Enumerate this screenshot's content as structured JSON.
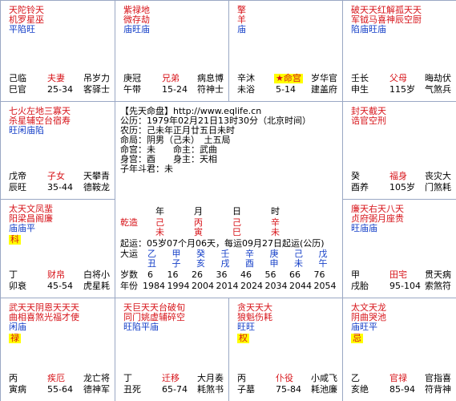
{
  "palaces": [
    {
      "id": "si",
      "stars": [
        [
          "天陀铃天",
          "red"
        ],
        [
          "机罗星巫",
          "red"
        ],
        [
          "平陷旺",
          "blue"
        ]
      ],
      "hua": "",
      "bottom": [
        [
          "己临",
          "夫妻",
          "吊岁力"
        ],
        [
          "巳官",
          "25-34",
          "客驿士"
        ]
      ]
    },
    {
      "id": "wu",
      "stars": [
        [
          "紫禄地",
          "red"
        ],
        [
          "微存劫",
          "red"
        ],
        [
          "庙旺庙",
          "blue"
        ]
      ],
      "hua": "",
      "bottom": [
        [
          "庚冠",
          "兄弟",
          "病息博"
        ],
        [
          "午带",
          "15-24",
          "符神士"
        ]
      ]
    },
    {
      "id": "wei",
      "stars": [
        [
          "擎",
          "red"
        ],
        [
          "羊",
          "red"
        ],
        [
          "庙",
          "blue"
        ]
      ],
      "hua": "",
      "bottom": [
        [
          "辛沐",
          "★命宫",
          "岁华官"
        ],
        [
          "未浴",
          "5-14",
          "建盖府"
        ]
      ]
    },
    {
      "id": "shen",
      "stars": [
        [
          "破天天红解孤天天",
          "red"
        ],
        [
          "军钺马喜神辰空厨",
          "red"
        ],
        [
          "陷庙旺庙",
          "blue"
        ]
      ],
      "hua": "",
      "bottom": [
        [
          "壬长",
          "父母",
          "晦劫伏"
        ],
        [
          "申生",
          "115岁",
          "气煞兵"
        ]
      ]
    },
    {
      "id": "chen",
      "stars": [
        [
          "七火左地三寡天",
          "red"
        ],
        [
          "杀星辅空台宿寿",
          "red"
        ],
        [
          "旺闲庙陷",
          "blue"
        ]
      ],
      "hua": "",
      "bottom": [
        [
          "戊帝",
          "子女",
          "天攀青"
        ],
        [
          "辰旺",
          "35-44",
          "德鞍龙"
        ]
      ]
    },
    {
      "id": "you",
      "stars": [
        [
          "封天截天",
          "red"
        ],
        [
          "诰官空刑",
          "red"
        ]
      ],
      "hua": "",
      "bottom": [
        [
          "癸",
          "福身",
          "丧灾大"
        ],
        [
          "酉养",
          "105岁",
          "门煞耗"
        ]
      ]
    },
    {
      "id": "mao",
      "stars": [
        [
          "太天文凤蜚",
          "red"
        ],
        [
          "阳梁昌阁廉",
          "red"
        ],
        [
          "庙庙平",
          "blue"
        ]
      ],
      "hua": "科",
      "bottom": [
        [
          "丁",
          "财帛",
          "白将小"
        ],
        [
          "卯衰",
          "45-54",
          "虎星耗"
        ]
      ]
    },
    {
      "id": "xu",
      "stars": [
        [
          "廉天右天八天",
          "red"
        ],
        [
          "贞府弼月座贵",
          "red"
        ],
        [
          "旺庙庙",
          "blue"
        ]
      ],
      "hua": "",
      "bottom": [
        [
          "甲",
          "田宅",
          "贯天病"
        ],
        [
          "戌胎",
          "95-104",
          "索煞符"
        ]
      ]
    },
    {
      "id": "yin",
      "stars": [
        [
          "武天天阴恩天天天",
          "red"
        ],
        [
          "曲相喜煞光福才使",
          "red"
        ],
        [
          "闲庙",
          "blue"
        ]
      ],
      "hua": "禄",
      "bottom": [
        [
          "丙",
          "疾厄",
          "龙亡将"
        ],
        [
          "寅病",
          "55-64",
          "德神军"
        ]
      ]
    },
    {
      "id": "chou",
      "stars": [
        [
          "天巨天天台破旬",
          "red"
        ],
        [
          "同门姚虚辅碎空",
          "red"
        ],
        [
          "旺陷平庙",
          "blue"
        ]
      ],
      "hua": "",
      "bottom": [
        [
          "丁",
          "迁移",
          "大月奏"
        ],
        [
          "丑死",
          "65-74",
          "耗煞书"
        ]
      ]
    },
    {
      "id": "zi",
      "stars": [
        [
          "贪天天大",
          "red"
        ],
        [
          "狼魁伤耗",
          "red"
        ],
        [
          "旺旺",
          "blue"
        ]
      ],
      "hua": "权",
      "bottom": [
        [
          "丙",
          "仆役",
          "小咸飞"
        ],
        [
          "子墓",
          "75-84",
          "耗池廉"
        ]
      ]
    },
    {
      "id": "hai",
      "stars": [
        [
          "太文天龙",
          "red"
        ],
        [
          "阴曲哭池",
          "red"
        ],
        [
          "庙旺平",
          "blue"
        ]
      ],
      "hua": "忌",
      "bottom": [
        [
          "乙",
          "官禄",
          "官指喜"
        ],
        [
          "亥绝",
          "85-94",
          "符背神"
        ]
      ]
    }
  ],
  "center": {
    "header": "【先天命盘】http://www.eqlife.cn",
    "lines": [
      "公历：1979年02月21日13时30分（北京时间）",
      "农历：己未年正月廿五日未时",
      "命局：阴男（己未）　土五局",
      "命宫：未　　命主：武曲",
      "身宫：酉　　身主：天相",
      "子年斗君：未"
    ],
    "pillars_head": [
      "年",
      "月",
      "日",
      "时"
    ],
    "qianzao": "乾造",
    "tiangan": [
      "己",
      "丙",
      "己",
      "辛"
    ],
    "dizhi": [
      "未",
      "寅",
      "巳",
      "未"
    ],
    "qiyun": "起运：05岁07个月06天，每运09月27日起运(公历)",
    "dayun_label": "大运",
    "dayun_gan": [
      "乙",
      "甲",
      "癸",
      "壬",
      "辛",
      "庚",
      "己",
      "戊"
    ],
    "dayun_zhi": [
      "丑",
      "子",
      "亥",
      "戌",
      "酉",
      "申",
      "未",
      "午"
    ],
    "suishu_label": "岁数",
    "suishu": [
      "6",
      "16",
      "26",
      "36",
      "46",
      "56",
      "66",
      "76"
    ],
    "nianfen_label": "年份",
    "nianfen": [
      "1984",
      "1994",
      "2004",
      "2014",
      "2024",
      "2034",
      "2044",
      "2054"
    ]
  },
  "colors": {
    "red": "#d7141a",
    "blue": "#1640c8",
    "highlight": "#ffff00",
    "border": "#9aa8c4"
  }
}
